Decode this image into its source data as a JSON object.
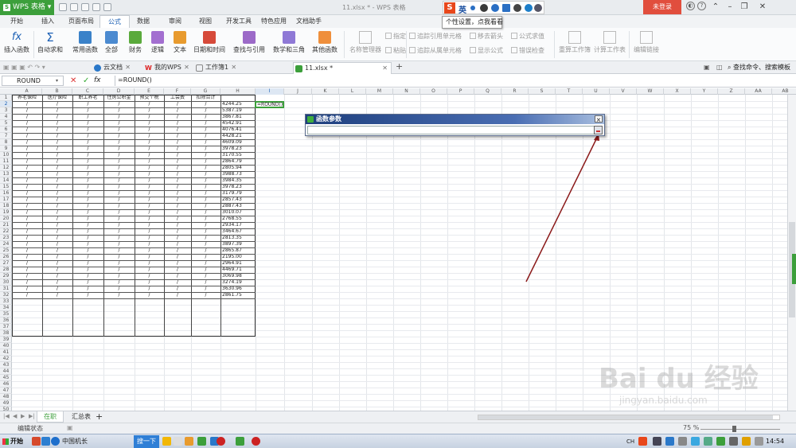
{
  "title_bar": {
    "app_name": "WPS 表格",
    "doc_title": "11.xlsx * - WPS 表格",
    "login_label": "未登录"
  },
  "ime": {
    "brand_glyph": "S",
    "mode_label": "英",
    "tooltip": "个性设置，点我看看"
  },
  "menu_tabs": [
    "开始",
    "插入",
    "页面布局",
    "公式",
    "数据",
    "审阅",
    "视图",
    "开发工具",
    "特色应用",
    "文档助手"
  ],
  "active_menu_tab": "公式",
  "ribbon": {
    "insert_function": "插入函数",
    "autosum": "自动求和",
    "common_functions": "常用函数",
    "all": "全部",
    "finance": "财务",
    "logic": "逻辑",
    "text": "文本",
    "datetime": "日期和时间",
    "lookup": "查找与引用",
    "math": "数学和三角",
    "other_functions": "其他函数",
    "name_manager": "名称管理器",
    "define": "指定",
    "paste": "粘贴",
    "trace_precedents": "追踪引用单元格",
    "trace_dependents": "追踪从属单元格",
    "remove_arrows": "移去箭头",
    "show_formulas": "显示公式",
    "formula_eval": "公式求值",
    "error_check": "错误检查",
    "recalc_book": "重算工作簿",
    "calc_sheet": "计算工作表",
    "edit_links": "编辑链接"
  },
  "doc_tabs": [
    {
      "label": "云文档"
    },
    {
      "label": "我的WPS"
    },
    {
      "label": "工作簿1"
    },
    {
      "label": "11.xlsx *"
    }
  ],
  "top_right": {
    "search_label": "查找命令、搜索模板"
  },
  "formula_bar": {
    "name_box": "ROUND",
    "fx_label": "fx",
    "formula": "=ROUND()"
  },
  "sheet": {
    "columns": [
      "A",
      "B",
      "C",
      "D",
      "E",
      "F",
      "G",
      "H",
      "I",
      "J",
      "K",
      "L",
      "M",
      "N",
      "O",
      "P",
      "Q",
      "R",
      "S",
      "T",
      "U",
      "V",
      "W",
      "X",
      "Y",
      "Z",
      "AA",
      "AB"
    ],
    "headers": [
      "养老保险",
      "医疗保险",
      "职工养老",
      "住房公积金",
      "预交个税",
      "工会费",
      "扣除合计"
    ],
    "dash": "/",
    "values": [
      "4244.25",
      "5387.19",
      "3867.81",
      "4542.91",
      "4076.41",
      "4428.21",
      "4609.09",
      "3978.23",
      "3170.55",
      "2864.79",
      "2805.94",
      "3988.73",
      "3984.35",
      "3978.23",
      "3179.79",
      "2857.43",
      "2887.43",
      "3010.07",
      "2768.55",
      "2934.17",
      "3464.67",
      "2813.35",
      "3897.39",
      "2865.87",
      "2195.00",
      "2964.91",
      "4469.71",
      "3069.98",
      "3274.19",
      "3630.96",
      "2861.75"
    ],
    "active_formula": "=ROUND()"
  },
  "dialog": {
    "title": "函数参数",
    "close_glyph": "×"
  },
  "sheet_tabs": [
    "在职",
    "汇总表"
  ],
  "status": {
    "mode": "编辑状态",
    "zoom": "75 %"
  },
  "taskbar": {
    "start": "开始",
    "window_item": "中国机长",
    "search_button": "搜一下",
    "lang": "CH",
    "clock": "14:54"
  },
  "watermark": {
    "brand": "Bai du 经验",
    "url": "jingyan.baidu.com"
  },
  "colors": {
    "brand_green": "#3c9f3b",
    "login_red": "#e14e3d",
    "arrow_red": "#8b1a1a"
  }
}
